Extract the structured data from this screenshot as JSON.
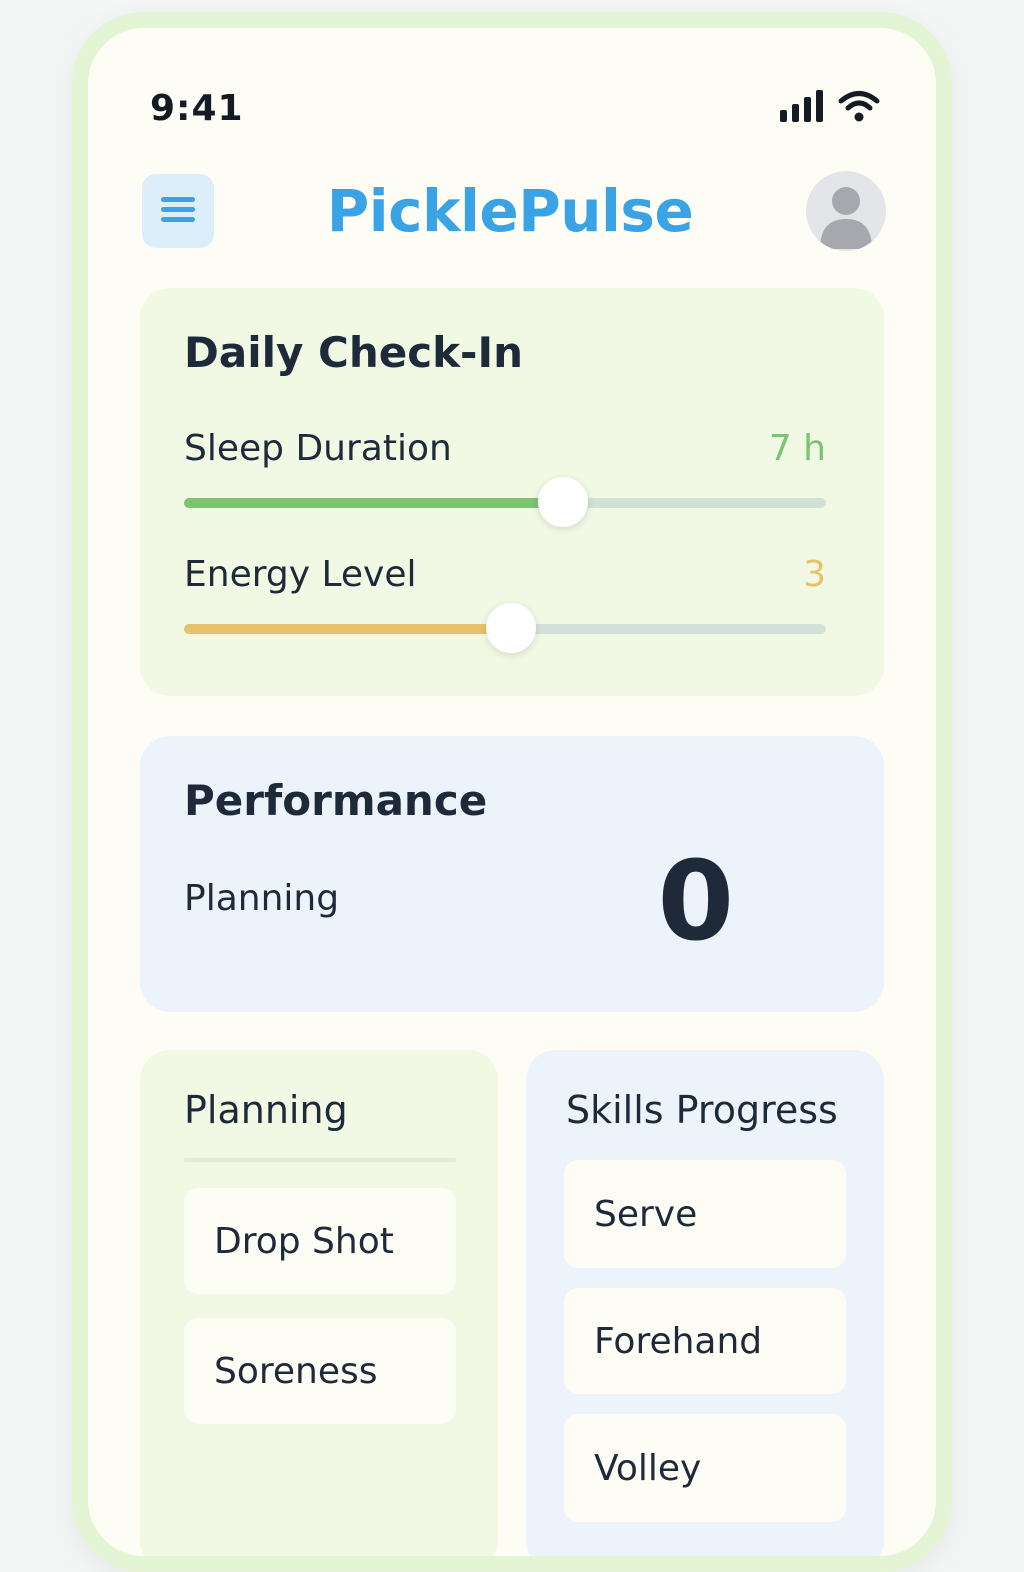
{
  "status_bar": {
    "time": "9:41",
    "icons": [
      "signal-icon",
      "wifi-icon"
    ]
  },
  "header": {
    "title": "PicklePulse",
    "menu_icon": "menu-icon",
    "avatar_icon": "user-avatar-icon"
  },
  "checkin": {
    "title": "Daily Check-In",
    "sleep": {
      "label": "Sleep Duration",
      "value": "7 h",
      "fraction": 0.59,
      "color": "#7cc46f",
      "value_color": "#7cc46f"
    },
    "energy": {
      "label": "Energy Level",
      "value": "3",
      "fraction": 0.51,
      "color": "#e8c26a",
      "value_color": "#e8c26a"
    }
  },
  "performance": {
    "title": "Performance",
    "label": "Planning",
    "score": "0"
  },
  "planning": {
    "title": "Planning",
    "items": [
      "Drop Shot",
      "Soreness"
    ]
  },
  "skills": {
    "title": "Skills Progress",
    "items": [
      "Serve",
      "Forehand",
      "Volley"
    ]
  },
  "colors": {
    "brand": "#3aa3e6",
    "frame": "#e4f5d6",
    "checkin_bg": "#f1f9e5",
    "performance_bg": "#edf3fb"
  }
}
